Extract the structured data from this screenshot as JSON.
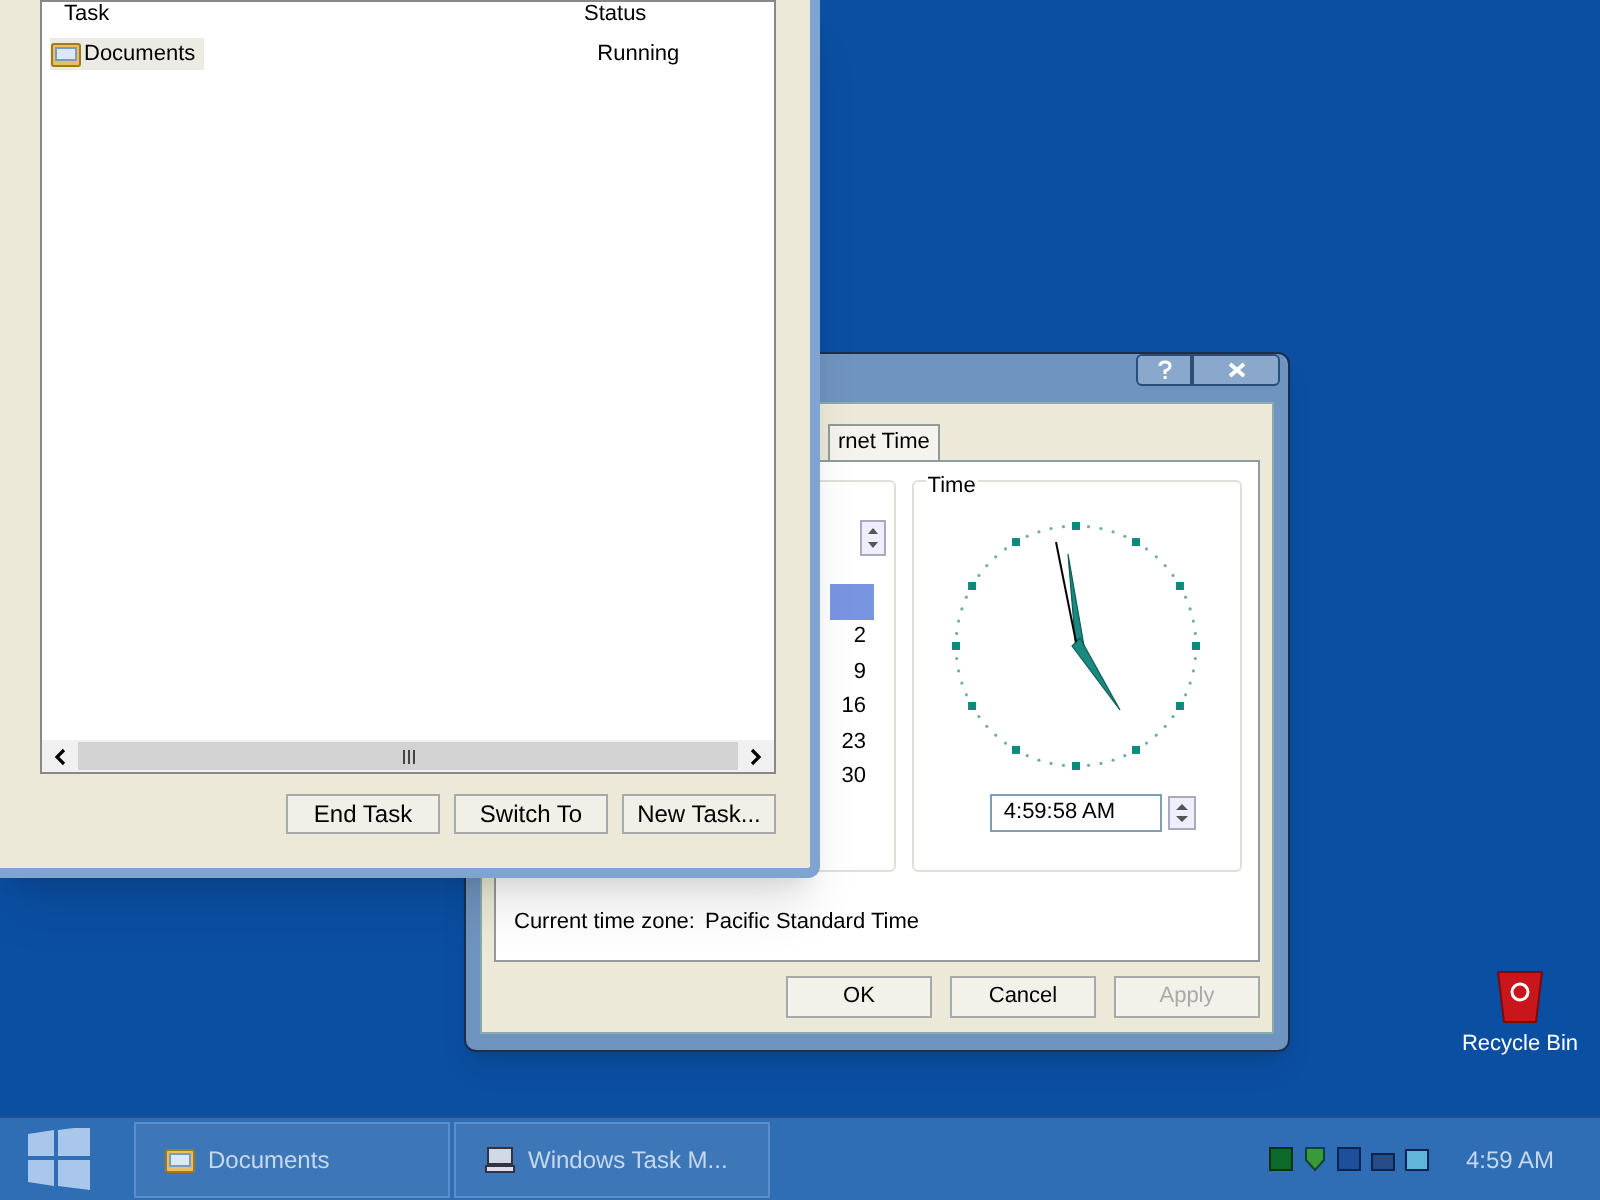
{
  "task_manager": {
    "columns": [
      "Task",
      "Status"
    ],
    "rows": [
      {
        "task": "Documents",
        "status": "Running",
        "selected": true
      }
    ],
    "buttons": [
      "End Task",
      "Switch To",
      "New Task..."
    ]
  },
  "date_time_dialog": {
    "tabs": [
      {
        "label": "rnet Time",
        "selected": false
      }
    ],
    "calendar_days": [
      "2",
      "9",
      "16",
      "23",
      "30"
    ],
    "time_group": {
      "label": "Time",
      "time": "4:59:58 AM"
    },
    "time_zone": {
      "label": "Current time zone:",
      "value": "Pacific Standard Time"
    },
    "buttons": [
      {
        "label": "OK",
        "disabled": false
      },
      {
        "label": "Cancel",
        "disabled": false
      },
      {
        "label": "Apply",
        "disabled": true
      }
    ]
  },
  "desktop_icons": [
    {
      "label": "Recycle Bin"
    }
  ],
  "taskbar": {
    "items": [
      {
        "label": "Documents",
        "kind": "folder"
      },
      {
        "label": "Windows Task M...",
        "kind": "computer"
      }
    ],
    "clock": "4:59 AM"
  }
}
